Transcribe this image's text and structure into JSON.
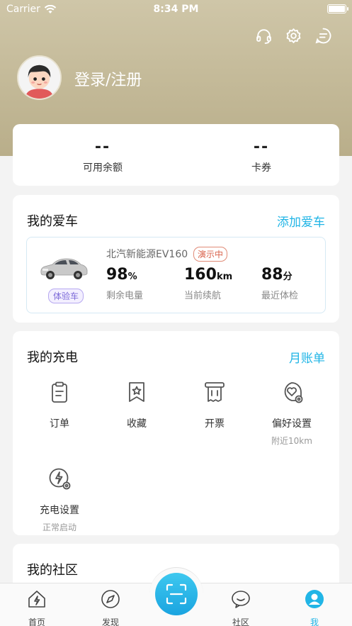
{
  "status_bar": {
    "carrier": "Carrier",
    "time": "8:34 PM"
  },
  "header": {
    "login_label": "登录/注册",
    "icons": [
      "headset-icon",
      "settings-icon",
      "message-icon"
    ]
  },
  "balance": {
    "items": [
      {
        "value": "--",
        "label": "可用余额"
      },
      {
        "value": "--",
        "label": "卡券"
      }
    ]
  },
  "my_car": {
    "title": "我的爱车",
    "link": "添加爱车",
    "car_name": "北汽新能源EV160",
    "demo_badge": "演示中",
    "trial_badge": "体验车",
    "stats": [
      {
        "value": "98",
        "unit": "%",
        "label": "剩余电量"
      },
      {
        "value": "160",
        "unit": "km",
        "label": "当前续航"
      },
      {
        "value": "88",
        "unit": "分",
        "label": "最近体检"
      }
    ]
  },
  "my_charging": {
    "title": "我的充电",
    "link": "月账单",
    "items": [
      {
        "label": "订单",
        "sub": "",
        "icon": "order-clipboard-icon"
      },
      {
        "label": "收藏",
        "sub": "",
        "icon": "favorite-star-icon"
      },
      {
        "label": "开票",
        "sub": "",
        "icon": "invoice-icon"
      },
      {
        "label": "偏好设置",
        "sub": "附近10km",
        "icon": "preference-heart-icon"
      },
      {
        "label": "充电设置",
        "sub": "正常启动",
        "icon": "charge-settings-icon"
      }
    ]
  },
  "community": {
    "title": "我的社区"
  },
  "tabbar": {
    "tabs": [
      {
        "label": "首页",
        "icon": "home-icon"
      },
      {
        "label": "发现",
        "icon": "compass-icon"
      },
      {
        "label": "社区",
        "icon": "chat-bubble-icon"
      },
      {
        "label": "我",
        "icon": "profile-icon",
        "active": true
      }
    ],
    "scan_icon": "scan-icon"
  },
  "colors": {
    "accent": "#21b5e6",
    "header": "#c4ba98",
    "demo": "#d9624b",
    "trial": "#7d6ad8"
  }
}
